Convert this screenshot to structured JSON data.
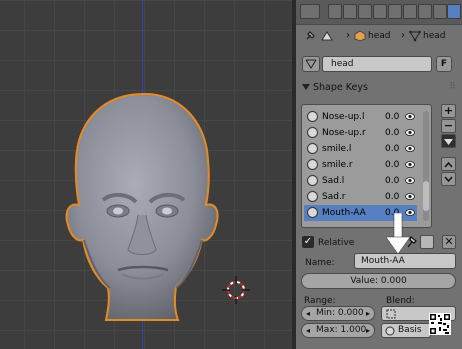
{
  "breadcrumb": {
    "object_name": "head",
    "mesh_name": "head"
  },
  "mesh_datablock": {
    "name": "head",
    "fake_user_label": "F"
  },
  "shape_keys_panel": {
    "title": "Shape Keys",
    "items": [
      {
        "name": "Nose-up.l",
        "value": "0.0"
      },
      {
        "name": "Nose-up.r",
        "value": "0.0"
      },
      {
        "name": "smile.l",
        "value": "0.0"
      },
      {
        "name": "smile.r",
        "value": "0.0"
      },
      {
        "name": "Sad.l",
        "value": "0.0"
      },
      {
        "name": "Sad.r",
        "value": "0.0"
      },
      {
        "name": "Mouth-AA",
        "value": "0.0",
        "selected": true
      }
    ],
    "add_label": "+",
    "remove_label": "−",
    "relative_label": "Relative",
    "name_label": "Name:",
    "name_value": "Mouth-AA",
    "value_text": "Value: 0.000",
    "range_label": "Range:",
    "blend_label": "Blend:",
    "min_text": "Min: 0.000",
    "max_text": "Max: 1.000",
    "basis_value": "Basis"
  },
  "colors": {
    "selection": "#5680c2",
    "viewport_bg": "#3d3d3d",
    "panel_bg": "#727272",
    "head_outline": "#e88a22"
  }
}
